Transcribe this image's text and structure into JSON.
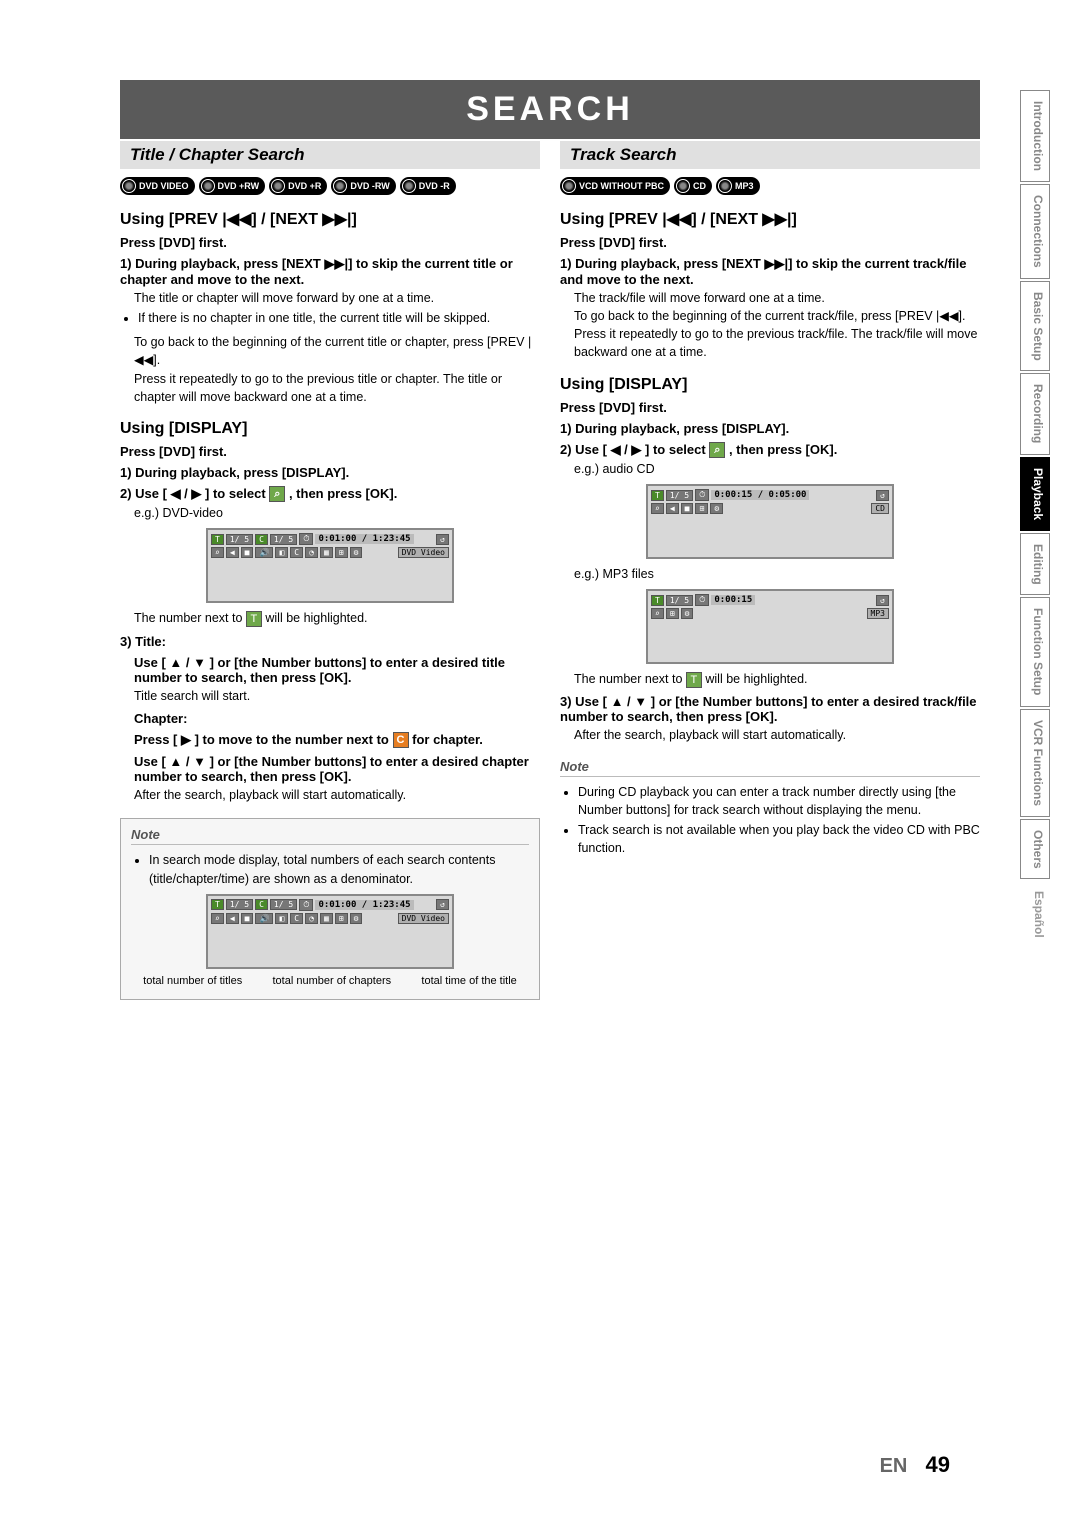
{
  "title": "SEARCH",
  "left": {
    "header": "Title / Chapter Search",
    "badges": [
      "DVD VIDEO",
      "DVD +RW",
      "DVD +R",
      "DVD -RW",
      "DVD -R"
    ],
    "using_prev_next_heading": "Using [PREV |◀◀] / [NEXT ▶▶|]",
    "press_dvd_first": "Press [DVD] first.",
    "step1": "1) During playback, press [NEXT ▶▶|] to skip the current title or chapter and move to the next.",
    "step1_body": "The title or chapter will move forward by one at a time.",
    "step1_bullet": "If there is no chapter in one title, the current title will be skipped.",
    "goback": "To go back to the beginning of the current title or chapter, press [PREV |◀◀].",
    "goback2": "Press it repeatedly to go to the previous title or chapter. The title or chapter will move backward one at a time.",
    "using_display_heading": "Using [DISPLAY]",
    "d_step1": "1) During playback, press [DISPLAY].",
    "d_step2_pre": "2) Use [ ◀ / ▶ ] to select",
    "d_step2_post": ", then press [OK].",
    "d_eg": "e.g.) DVD-video",
    "d_highlight_pre": "The number next to",
    "d_highlight_post": "will be highlighted.",
    "d_step3_label": "3) Title:",
    "d_step3_use": "Use [ ▲ / ▼ ] or [the Number buttons] to enter a desired title number to search, then press [OK].",
    "d_step3_body": "Title search will start.",
    "chapter_label": "Chapter:",
    "chapter_press_pre": "Press [ ▶ ] to move to the number next to",
    "chapter_press_post": "for chapter.",
    "chapter_use": "Use [ ▲ / ▼ ] or [the Number buttons] to enter a desired chapter number to search, then press [OK].",
    "chapter_body": "After the search, playback will start automatically.",
    "note_title": "Note",
    "note_body": "In search mode display, total numbers of each search contents (title/chapter/time) are shown as a denominator.",
    "diagram_labels": {
      "titles": "total number of titles",
      "chapters": "total number of chapters",
      "time": "total time of the title"
    },
    "osd": {
      "t": "1/ 5",
      "c": "1/ 5",
      "time": "0:01:00 / 1:23:45",
      "r": "DVD Video"
    }
  },
  "right": {
    "header": "Track Search",
    "badges": [
      "VCD WITHOUT PBC",
      "CD",
      "MP3"
    ],
    "using_prev_next_heading": "Using [PREV |◀◀] / [NEXT ▶▶|]",
    "press_dvd_first": "Press [DVD] first.",
    "step1": "1) During playback, press [NEXT ▶▶|] to skip the current track/file and move to the next.",
    "step1_body": "The track/file will move forward one at a time.",
    "goback": "To go back to the beginning of the current track/file, press [PREV |◀◀].",
    "goback2": "Press it repeatedly to go to the previous track/file. The track/file will move backward one at a time.",
    "using_display_heading": "Using [DISPLAY]",
    "d_step1": "1) During playback, press [DISPLAY].",
    "d_step2_pre": "2) Use [ ◀ / ▶ ] to select",
    "d_step2_post": ", then press [OK].",
    "d_eg1": "e.g.) audio CD",
    "d_eg2": "e.g.) MP3 files",
    "d_highlight_pre": "The number next to",
    "d_highlight_post": "will be highlighted.",
    "d_step3": "3) Use [ ▲ / ▼ ] or [the Number buttons] to enter a desired track/file number to search, then press [OK].",
    "d_step3_body": "After the search, playback will start automatically.",
    "note_title": "Note",
    "note_b1": "During CD playback you can enter a track number directly using [the Number buttons] for track search without displaying the menu.",
    "note_b2": "Track search is not available when you play back the video CD with PBC function.",
    "osd1": {
      "t": "1/ 5",
      "time": "0:00:15 / 0:05:00",
      "r": "CD"
    },
    "osd2": {
      "t": "1/ 5",
      "time": "0:00:15",
      "r": "MP3"
    }
  },
  "tabs": [
    "Introduction",
    "Connections",
    "Basic Setup",
    "Recording",
    "Playback",
    "Editing",
    "Function Setup",
    "VCR Functions",
    "Others",
    "Español"
  ],
  "active_tab": "Playback",
  "footer_lang": "EN",
  "footer_page": "49"
}
